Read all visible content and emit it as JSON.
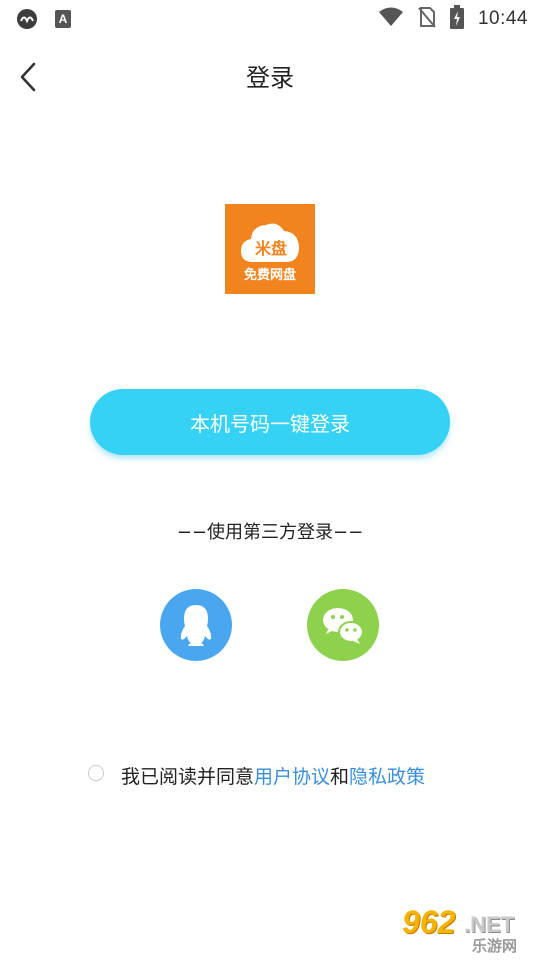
{
  "status_bar": {
    "time": "10:44",
    "icons": [
      "cast-icon",
      "accessibility-a-icon",
      "wifi-icon",
      "no-sim-icon",
      "battery-charging-icon"
    ]
  },
  "header": {
    "title": "登录",
    "back_icon": "chevron-left-icon"
  },
  "logo": {
    "text_top": "米盘",
    "text_bottom": "免费网盘",
    "background": "#f2841f"
  },
  "login": {
    "one_click_label": "本机号码一键登录",
    "button_color": "#35d2f6"
  },
  "third_party": {
    "label": "−−使用第三方登录−−",
    "providers": [
      {
        "name": "qq",
        "icon": "qq-penguin-icon",
        "color": "#4aa7ef"
      },
      {
        "name": "wechat",
        "icon": "wechat-icon",
        "color": "#8ed14d"
      }
    ]
  },
  "agreement": {
    "checked": false,
    "prefix": "我已阅读并同意",
    "user_agreement": "用户协议",
    "conjunction": "和",
    "privacy_policy": "隐私政策",
    "link_color": "#3a8fdb"
  },
  "watermark": {
    "number": "962",
    "domain": ".NET",
    "subtitle": "乐游网"
  }
}
